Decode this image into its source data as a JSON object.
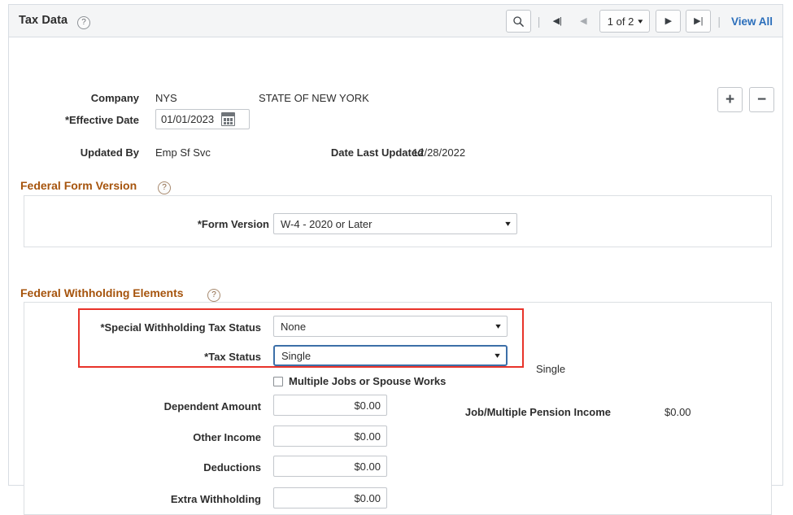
{
  "header": {
    "title": "Tax Data",
    "help_icon": "question-circle-icon",
    "search_icon": "search-icon",
    "first_icon": "first-page-icon",
    "prev_icon": "previous-page-icon",
    "next_icon": "next-page-icon",
    "last_icon": "last-page-icon",
    "separator": "|",
    "page_indicator": "1 of 2",
    "page_caret": "⌄",
    "view_all": "View All"
  },
  "row_actions": {
    "add_label": "+",
    "delete_label": "−"
  },
  "identity": {
    "company_label": "Company",
    "company_value": "NYS",
    "company_description": "STATE OF NEW YORK",
    "effective_date_label": "*Effective Date",
    "effective_date_value": "01/01/2023",
    "calendar_icon": "calendar-icon",
    "updated_by_label": "Updated By",
    "updated_by_value": "Emp Sf Svc",
    "date_last_updated_label": "Date Last Updated",
    "date_last_updated_value": "12/28/2022"
  },
  "form_version_section": {
    "title": "Federal Form Version",
    "help_icon": "question-circle-icon",
    "form_version_label": "*Form Version",
    "form_version_value": "W-4 - 2020 or Later",
    "caret": "⌄"
  },
  "withholding_section": {
    "title": "Federal Withholding Elements",
    "help_icon": "question-circle-icon",
    "special_status_label": "*Special Withholding Tax Status",
    "special_status_value": "None",
    "tax_status_label": "*Tax Status",
    "tax_status_value": "Single",
    "tax_status_readonly": "Single",
    "multiple_jobs_label": "Multiple Jobs or Spouse Works",
    "multiple_jobs_checked": false,
    "dependent_amount_label": "Dependent Amount",
    "dependent_amount_value": "$0.00",
    "other_income_label": "Other Income",
    "other_income_value": "$0.00",
    "deductions_label": "Deductions",
    "deductions_value": "$0.00",
    "extra_withholding_label": "Extra Withholding",
    "extra_withholding_value": "$0.00",
    "job_pension_label": "Job/Multiple Pension Income",
    "job_pension_value": "$0.00",
    "caret": "⌄"
  },
  "colors": {
    "accent_link": "#2a6ebb",
    "group_header": "#a6540d",
    "highlight_box": "#e8332a",
    "focus_border": "#3c6fa8",
    "panel_border": "#dcdfe3",
    "header_bg": "#f4f5f6"
  }
}
